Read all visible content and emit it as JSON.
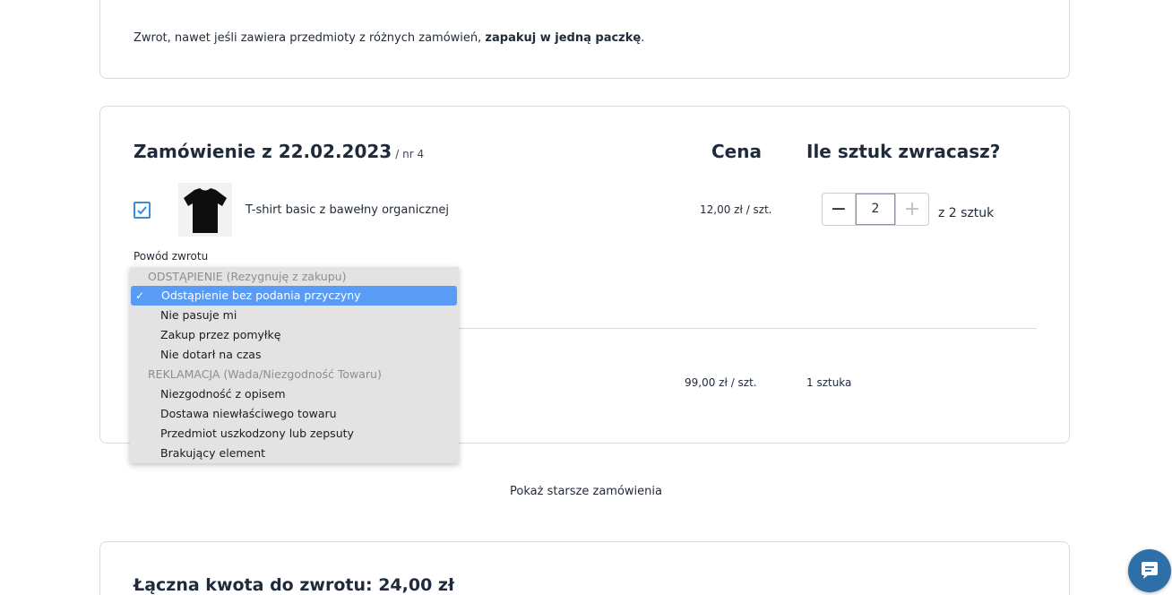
{
  "info": {
    "text": "Zwrot, nawet jeśli zawiera przedmioty z różnych zamówień,",
    "bold": "zapakuj w jedną paczkę",
    "end": "."
  },
  "order": {
    "title": "Zamówienie z 22.02.2023",
    "nr": "/ nr 4",
    "col_price": "Cena",
    "col_qty": "Ile sztuk zwracasz?",
    "item": {
      "name": "T-shirt basic z bawełny organicznej",
      "unit_price": "12,00 zł / szt.",
      "qty_value": "2",
      "qty_of": "z 2 sztuk"
    },
    "reason_label": "Powód zwrotu",
    "item2": {
      "unit_price": "99,00 zł / szt.",
      "qty": "1 sztuka"
    }
  },
  "dropdown": {
    "groups": [
      {
        "label": "ODSTĄPIENIE (Rezygnuję z zakupu)",
        "options": [
          "Odstąpienie bez podania przyczyny",
          "Nie pasuje mi",
          "Zakup przez pomyłkę",
          "Nie dotarł na czas"
        ]
      },
      {
        "label": "REKLAMACJA (Wada/Niezgodność Towaru)",
        "options": [
          "Niezgodność z opisem",
          "Dostawa niewłaściwego towaru",
          "Przedmiot uszkodzony lub zepsuty",
          "Brakujący element"
        ]
      }
    ],
    "selected_check": "✓"
  },
  "older_orders": "Pokaż starsze zamówienia",
  "total": {
    "title": "Łączna kwota do zwrotu: 24,00 zł"
  },
  "icons": {
    "checkbox": "check-icon",
    "minus": "minus-icon",
    "plus": "plus-icon",
    "chat": "chat-icon"
  },
  "colors": {
    "accent": "#3a8ed6",
    "selected": "#5a9cf5",
    "chat": "#2f6fa8"
  }
}
